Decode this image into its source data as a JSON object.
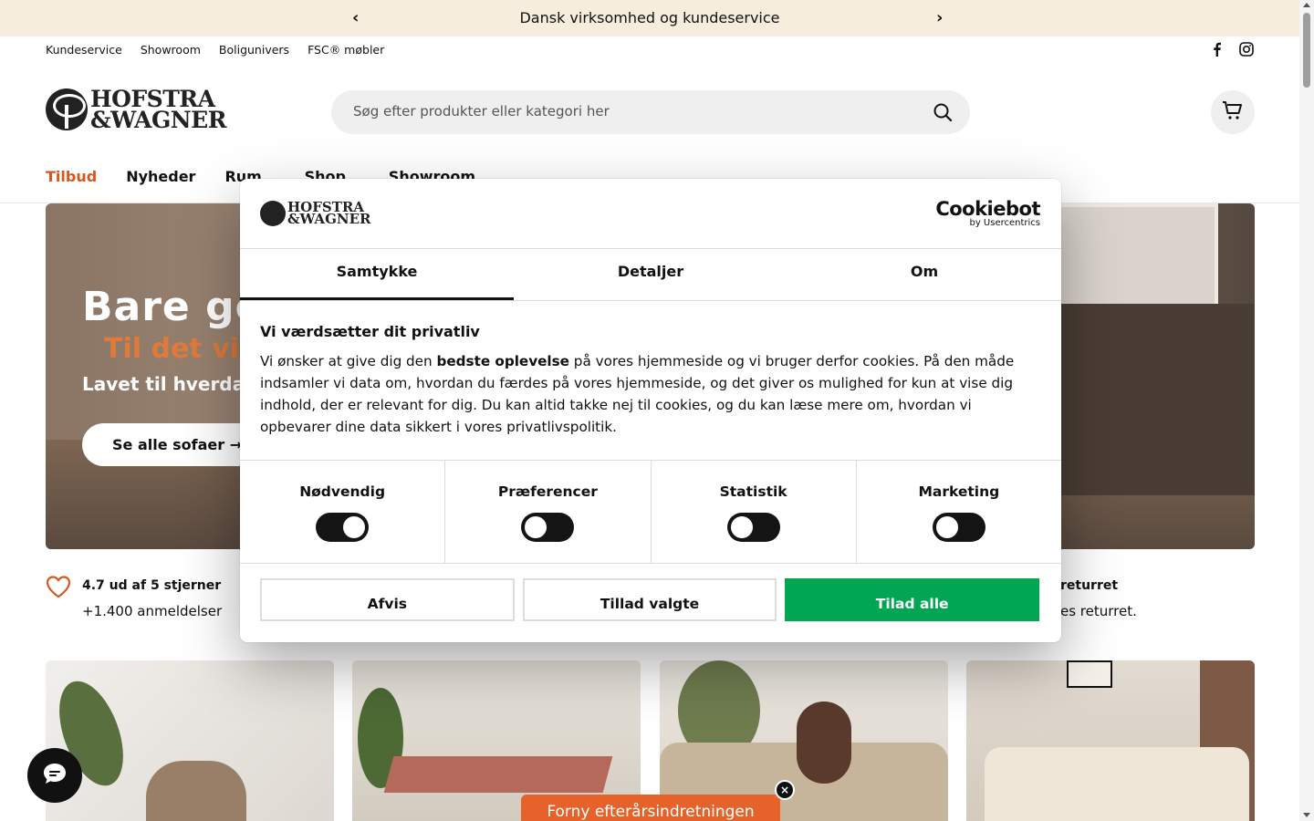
{
  "announcement": {
    "text": "Dansk virksomhed og kundeservice"
  },
  "util_links": [
    "Kundeservice",
    "Showroom",
    "Boligunivers",
    "FSC® møbler"
  ],
  "brand": {
    "line1": "HOFSTRA",
    "line2": "&WAGNER"
  },
  "search": {
    "placeholder": "Søg efter produkter eller kategori her"
  },
  "nav": {
    "tilbud": "Tilbud",
    "nyheder": "Nyheder",
    "rum": "Rum",
    "shop": "Shop",
    "showroom": "Showroom"
  },
  "hero": {
    "title": "Bare go",
    "subtitle": "Til det vi",
    "tagline": "Lavet til hverda",
    "cta": "Se alle sofaer →"
  },
  "usps": [
    {
      "title": "4.7 ud af 5 stjerner",
      "text": "+1.400 anmeldelser"
    },
    {
      "title": "returret",
      "text": "es returret."
    }
  ],
  "promo": {
    "label": "Forny efterårsindretningen",
    "close": "×"
  },
  "cookie": {
    "provider": {
      "name": "Cookiebot",
      "by": "by Usercentrics"
    },
    "tabs": [
      "Samtykke",
      "Detaljer",
      "Om"
    ],
    "heading": "Vi værdsætter dit privatliv",
    "body_before": "Vi ønsker at give dig den ",
    "body_bold": "bedste oplevelse",
    "body_after": " på vores hjemmeside og vi bruger derfor cookies. På den måde indsamler vi data om, hvordan du færdes på vores hjemmeside, og det giver os mulighed for kun at vise dig indhold, der er relevant for dig. Du kan altid takke nej til cookies, og du kan læse mere om, hvordan vi opbevarer dine data sikkert i vores privatlivspolitik.",
    "toggles": [
      {
        "label": "Nødvendig",
        "on": true
      },
      {
        "label": "Præferencer",
        "on": false
      },
      {
        "label": "Statistik",
        "on": false
      },
      {
        "label": "Marketing",
        "on": false
      }
    ],
    "buttons": {
      "reject": "Afvis",
      "allow_selected": "Tillad valgte",
      "allow_all": "Tilad alle"
    }
  },
  "colors": {
    "accent": "#d4581e",
    "announce_bg": "#f6eddd",
    "consent_green": "#00a651",
    "promo": "#e5622a"
  }
}
